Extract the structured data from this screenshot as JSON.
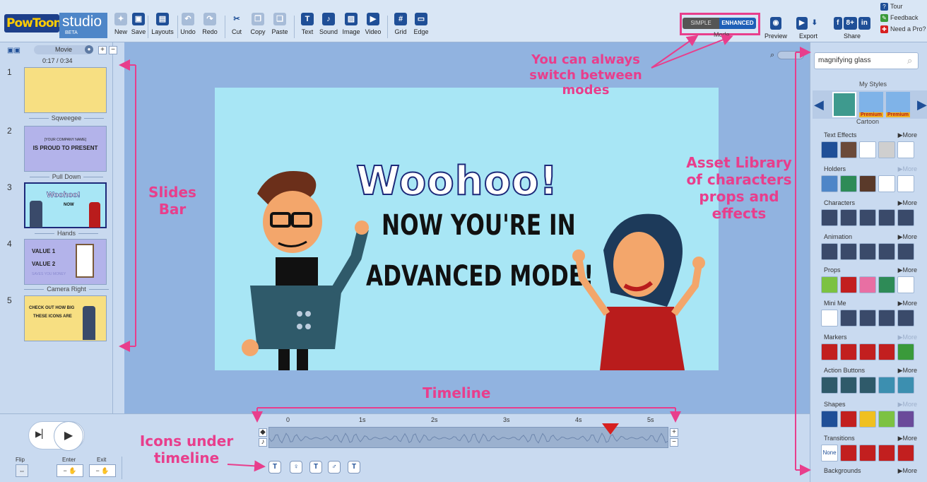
{
  "toolbar": {
    "logo": "PowToon",
    "studio": "studio",
    "beta": "BETA",
    "items": [
      {
        "label": "New",
        "icon": "new-icon",
        "glyph": "✦"
      },
      {
        "label": "Save",
        "icon": "save-icon",
        "glyph": "▣"
      },
      {
        "label": "Layouts",
        "icon": "layouts-icon",
        "glyph": "▤"
      },
      {
        "label": "Undo",
        "icon": "undo-icon",
        "glyph": "↶"
      },
      {
        "label": "Redo",
        "icon": "redo-icon",
        "glyph": "↷"
      },
      {
        "label": "Cut",
        "icon": "cut-icon",
        "glyph": "✂"
      },
      {
        "label": "Copy",
        "icon": "copy-icon",
        "glyph": "❐"
      },
      {
        "label": "Paste",
        "icon": "paste-icon",
        "glyph": "❏"
      },
      {
        "label": "Text",
        "icon": "text-icon",
        "glyph": "T"
      },
      {
        "label": "Sound",
        "icon": "sound-icon",
        "glyph": "♪"
      },
      {
        "label": "Image",
        "icon": "image-icon",
        "glyph": "▨"
      },
      {
        "label": "Video",
        "icon": "video-icon",
        "glyph": "▶"
      },
      {
        "label": "Grid",
        "icon": "grid-icon",
        "glyph": "#"
      },
      {
        "label": "Edge",
        "icon": "edge-icon",
        "glyph": "▭"
      }
    ],
    "mode_simple": "SIMPLE",
    "mode_enhanced": "ENHANCED",
    "mode_label": "Mode",
    "preview": "Preview",
    "export": "Export",
    "share": "Share",
    "tour": "Tour",
    "feedback": "Feedback",
    "need_pro": "Need a Pro?"
  },
  "slides": {
    "movie_label": "Movie",
    "timecode": "0:17 / 0:34",
    "items": [
      {
        "num": "1",
        "transition": "Sqweegee"
      },
      {
        "num": "2",
        "text1": "[YOUR COMPANY NAME]",
        "text2": "IS PROUD TO PRESENT",
        "transition": "Pull Down"
      },
      {
        "num": "3",
        "text1": "Woohoo!",
        "text2": "NOW",
        "transition": "Hands"
      },
      {
        "num": "4",
        "text1": "VALUE 1",
        "text2": "VALUE 2",
        "text3": "SAVES YOU MONEY",
        "transition": "Camera Right"
      },
      {
        "num": "5",
        "text1": "CHECK OUT HOW BIG",
        "text2": "THESE ICONS ARE"
      }
    ]
  },
  "stage": {
    "title": "Woohoo!",
    "line1": "NOW YOU'RE IN",
    "line2": "ADVANCED MODE!"
  },
  "assets": {
    "search": "magnifying glass",
    "my_styles": "My Styles",
    "cartoon": "Cartoon",
    "premium": "Premium",
    "more": "▶More",
    "categories": [
      "Text Effects",
      "Holders",
      "Characters",
      "Animation",
      "Props",
      "Mini Me",
      "Markers",
      "Action Buttons",
      "Shapes",
      "Transitions",
      "Backgrounds"
    ],
    "transition_none": "None"
  },
  "timeline": {
    "ticks": [
      "0",
      "1s",
      "2s",
      "3s",
      "4s",
      "5s"
    ],
    "flip": "Flip",
    "enter": "Enter",
    "exit": "Exit"
  },
  "annotations": {
    "modes": "You can always switch between modes",
    "slides": "Slides Bar",
    "asset": "Asset Library of characters props and effects",
    "timeline": "Timeline",
    "icons": "Icons under timeline"
  },
  "colors": {
    "annotation": "#e83e8c",
    "toolbar_icon": "#1f4f97"
  }
}
